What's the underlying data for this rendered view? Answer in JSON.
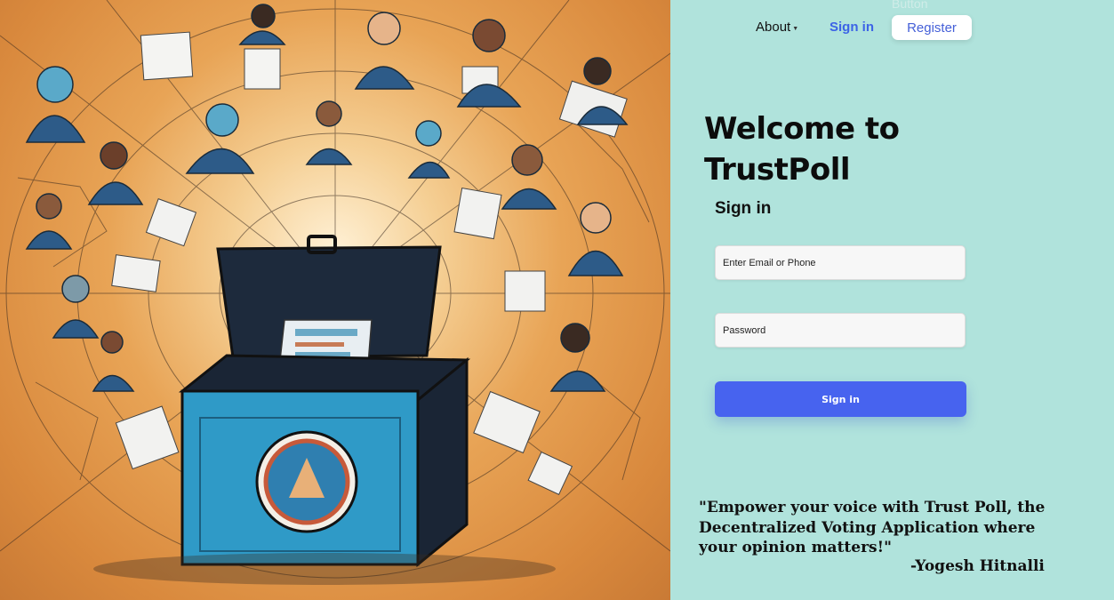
{
  "nav": {
    "about_label": "About",
    "signin_label": "Sign in",
    "ghost_label": "Button",
    "register_label": "Register"
  },
  "hero": {
    "title": "Welcome to TrustPoll"
  },
  "form": {
    "heading": "Sign in",
    "email_placeholder": "Enter Email or Phone",
    "password_placeholder": "Password",
    "submit_label": "Sign in"
  },
  "quote": {
    "text": "\"Empower your voice with Trust Poll, the Decentralized Voting Application where your opinion matters!\"",
    "author": "-Yogesh Hitnalli"
  },
  "colors": {
    "panel_bg": "#b0e3dc",
    "accent_blue": "#4763ef",
    "link_blue": "#3c63e6",
    "art_orange": "#e8a456",
    "ballot_box_blue": "#2f9ac7"
  }
}
